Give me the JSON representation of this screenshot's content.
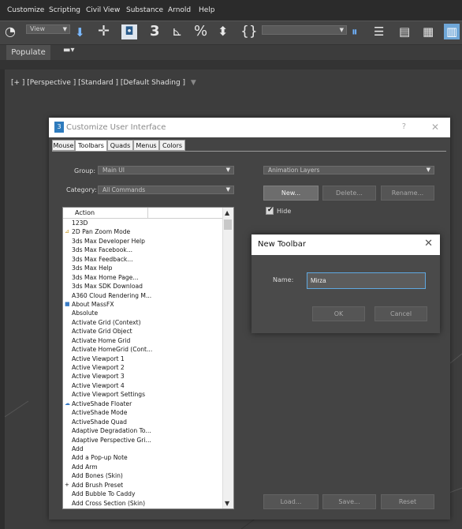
{
  "menubar": {
    "items": [
      "Customize",
      "Scripting",
      "Civil View",
      "Substance",
      "Arnold",
      "Help"
    ]
  },
  "toolbar": {
    "view_dropdown": "View"
  },
  "ribbon": {
    "populate_tab": "Populate"
  },
  "viewport": {
    "label": "[+ ] [Perspective ] [Standard ] [Default Shading ]"
  },
  "customize_dialog": {
    "title": "Customize User Interface",
    "help": "?",
    "close": "✕",
    "tabs": [
      "Mouse",
      "Toolbars",
      "Quads",
      "Menus",
      "Colors"
    ],
    "active_tab": "Toolbars",
    "group_label": "Group:",
    "group_value": "Main UI",
    "category_label": "Category:",
    "category_value": "All Commands",
    "toolbar_select": "Animation Layers",
    "new_button": "New...",
    "delete_button": "Delete...",
    "rename_button": "Rename...",
    "hide_label": "Hide",
    "hide_checked": true,
    "load_button": "Load...",
    "save_button": "Save...",
    "reset_button": "Reset",
    "list_header": "Action",
    "actions": [
      "123D",
      "2D Pan Zoom Mode",
      "3ds Max Developer Help",
      "3ds Max Facebook...",
      "3ds Max Feedback...",
      "3ds Max Help",
      "3ds Max Home Page...",
      "3ds Max SDK Download",
      "A360 Cloud Rendering M...",
      "About MassFX",
      "Absolute",
      "Activate Grid (Context)",
      "Activate Grid Object",
      "Activate Home Grid",
      "Activate HomeGrid (Cont...",
      "Active Viewport 1",
      "Active Viewport 2",
      "Active Viewport 3",
      "Active Viewport 4",
      "Active Viewport Settings",
      "ActiveShade Floater",
      "ActiveShade Mode",
      "ActiveShade Quad",
      "Adaptive Degradation To...",
      "Adaptive Perspective Gri...",
      "Add",
      "Add a Pop-up Note",
      "Add Arm",
      "Add Bones (Skin)",
      "Add Brush Preset",
      "Add Bubble To Caddy",
      "Add Cross Section (Skin)"
    ]
  },
  "new_toolbar_dialog": {
    "title": "New Toolbar",
    "close": "✕",
    "name_label": "Name:",
    "name_value": "Mirza",
    "ok_button": "OK",
    "cancel_button": "Cancel"
  }
}
